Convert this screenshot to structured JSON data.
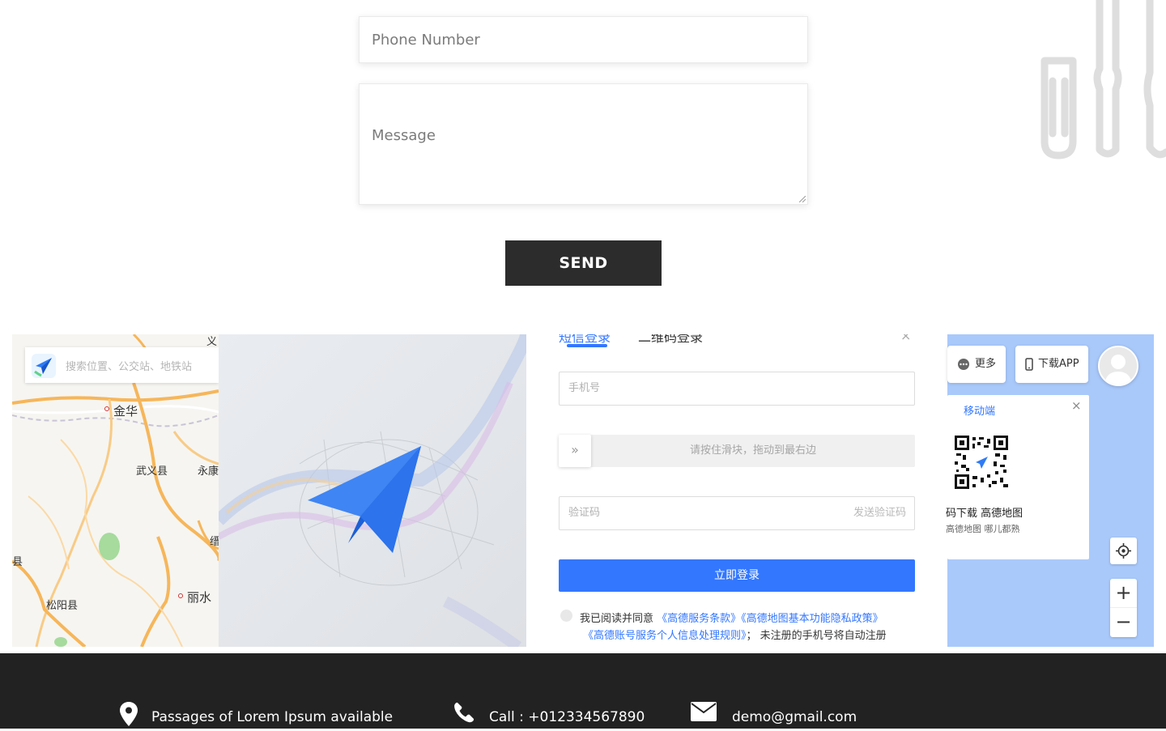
{
  "contact_form": {
    "phone_placeholder": "Phone Number",
    "message_placeholder": "Message",
    "send_label": "SEND"
  },
  "map": {
    "search_placeholder": "搜索位置、公交站、地铁站",
    "places": [
      "金华",
      "武义县",
      "永康",
      "缙",
      "丽水",
      "松阳县",
      "县",
      "义"
    ],
    "login": {
      "tab_sms": "短信登录",
      "tab_qr": "二维码登录",
      "close": "×",
      "phone_placeholder": "手机号",
      "slider_handle": "»",
      "slider_text": "请按住滑块，拖动到最右边",
      "code_placeholder": "验证码",
      "send_code": "发送验证码",
      "login_button": "立即登录",
      "agree_prefix": "我已阅读并同意",
      "terms_link": "《高德服务条款》",
      "privacy_link": "《高德地图基本功能隐私政策》",
      "account_link": "《高德账号服务个人信息处理规则》",
      "agree_suffix": "； 未注册的手机号将自动注册"
    },
    "toolbar": {
      "more_label": "更多",
      "app_label": "下载APP"
    },
    "qr_card": {
      "tab": "移动端",
      "close": "×",
      "line1": "码下载 高德地图",
      "line2": "高德地图 哪儿都熟"
    },
    "zoom_in": "+",
    "zoom_out": "−"
  },
  "footer": {
    "address": "Passages of Lorem Ipsum available",
    "phone": "Call : +012334567890",
    "email": "demo@gmail.com"
  },
  "colors": {
    "accent": "#3377ff",
    "button_dark": "#2c2c2c",
    "footer_bg": "#222222",
    "water": "#a9c9fb"
  }
}
